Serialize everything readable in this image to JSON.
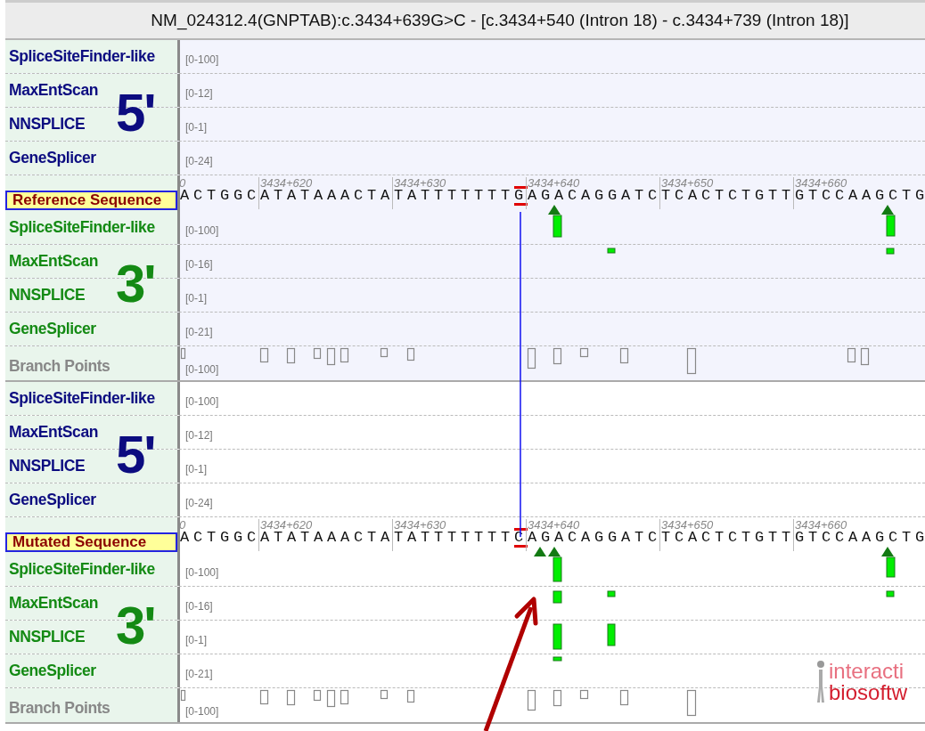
{
  "title": "NM_024312.4(GNPTAB):c.3434+639G>C - [c.3434+540 (Intron 18) - c.3434+739 (Intron 18)]",
  "panels": [
    {
      "kind": "reference",
      "five_prime": {
        "label": "5'",
        "tracks": [
          {
            "name": "SpliceSiteFinder-like",
            "range": "[0-100]"
          },
          {
            "name": "MaxEntScan",
            "range": "[0-12]"
          },
          {
            "name": "NNSPLICE",
            "range": "[0-1]"
          },
          {
            "name": "GeneSplicer",
            "range": "[0-24]"
          }
        ]
      },
      "sequence": {
        "label": "Reference Sequence",
        "bases_before": "ACTGGCATATAAACTATATTTTTTT",
        "variant_base": "G",
        "bases_after": "AGACAGGATCTCACTCTGTTGTCCAAGCTG",
        "ruler_cut_label": "0",
        "ruler": [
          "3434+620",
          "3434+630",
          "3434+640",
          "3434+650",
          "3434+660"
        ]
      },
      "three_prime": {
        "label": "3'",
        "tracks": [
          {
            "name": "SpliceSiteFinder-like",
            "range": "[0-100]"
          },
          {
            "name": "MaxEntScan",
            "range": "[0-16]"
          },
          {
            "name": "NNSPLICE",
            "range": "[0-1]"
          },
          {
            "name": "GeneSplicer",
            "range": "[0-21]"
          }
        ]
      },
      "branch_points": {
        "name": "Branch Points",
        "range": "[0-100]"
      }
    },
    {
      "kind": "mutated",
      "five_prime": {
        "label": "5'",
        "tracks": [
          {
            "name": "SpliceSiteFinder-like",
            "range": "[0-100]"
          },
          {
            "name": "MaxEntScan",
            "range": "[0-12]"
          },
          {
            "name": "NNSPLICE",
            "range": "[0-1]"
          },
          {
            "name": "GeneSplicer",
            "range": "[0-24]"
          }
        ]
      },
      "sequence": {
        "label": "Mutated Sequence",
        "bases_before": "ACTGGCATATAAACTATATTTTTTT",
        "variant_base": "C",
        "bases_after": "AGACAGGATCTCACTCTGTTGTCCAAGCTG",
        "ruler_cut_label": "0",
        "ruler": [
          "3434+620",
          "3434+630",
          "3434+640",
          "3434+650",
          "3434+660"
        ]
      },
      "three_prime": {
        "label": "3'",
        "tracks": [
          {
            "name": "SpliceSiteFinder-like",
            "range": "[0-100]"
          },
          {
            "name": "MaxEntScan",
            "range": "[0-16]"
          },
          {
            "name": "NNSPLICE",
            "range": "[0-1]"
          },
          {
            "name": "GeneSplicer",
            "range": "[0-21]"
          }
        ]
      },
      "branch_points": {
        "name": "Branch Points",
        "range": "[0-100]"
      }
    }
  ],
  "logo": {
    "line_1": "interacti",
    "line_2": "biosoftw"
  }
}
